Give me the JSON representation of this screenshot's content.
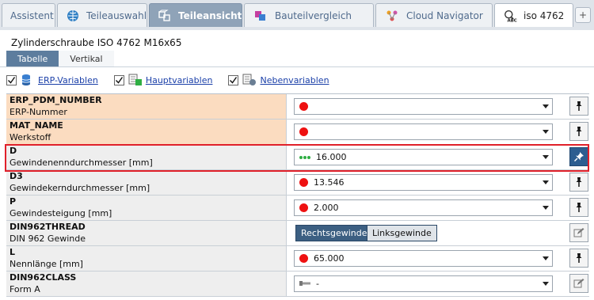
{
  "tabs": [
    {
      "label": "Assistent",
      "icon": "",
      "active": false
    },
    {
      "label": "Teileauswahl",
      "icon": "globe-icon",
      "active": false
    },
    {
      "label": "Teileansicht",
      "icon": "parts-view-icon",
      "active": true
    },
    {
      "label": "Bauteilvergleich",
      "icon": "compare-icon",
      "active": false
    },
    {
      "label": "Cloud Navigator",
      "icon": "cloud-navigator-icon",
      "active": false
    },
    {
      "label": "iso 4762",
      "icon": "abc-search-icon",
      "active": false
    }
  ],
  "plus_label": "+",
  "part_title": "Zylinderschraube ISO 4762 M16x65",
  "subtabs": [
    {
      "label": "Tabelle",
      "active": true
    },
    {
      "label": "Vertikal",
      "active": false
    }
  ],
  "filters": [
    {
      "label": "ERP-Variablen",
      "checked": true,
      "icon": "database-icon"
    },
    {
      "label": "Hauptvariablen",
      "checked": true,
      "icon": "main-variables-icon"
    },
    {
      "label": "Nebenvariablen",
      "checked": true,
      "icon": "secondary-variables-icon"
    }
  ],
  "rows": [
    {
      "key": "ERP_PDM_NUMBER",
      "desc": "ERP-Nummer",
      "value": "",
      "status": "red",
      "orange": true,
      "action": "pin"
    },
    {
      "key": "MAT_NAME",
      "desc": "Werkstoff",
      "value": "",
      "status": "red",
      "orange": true,
      "action": "pin"
    },
    {
      "key": "D",
      "desc": "Gewindenenndurchmesser [mm]",
      "value": "16.000",
      "status": "green",
      "orange": false,
      "action": "pin-active"
    },
    {
      "key": "D3",
      "desc": "Gewindekerndurchmesser [mm]",
      "value": "13.546",
      "status": "red",
      "orange": false,
      "action": "pin"
    },
    {
      "key": "P",
      "desc": "Gewindesteigung [mm]",
      "value": "2.000",
      "status": "red",
      "orange": false,
      "action": "pin"
    },
    {
      "key": "DIN962THREAD",
      "desc": "DIN 962 Gewinde",
      "value": "",
      "status": "none",
      "orange": false,
      "action": "edit",
      "buttons": [
        "Rechtsgewinde",
        "Linksgewinde"
      ]
    },
    {
      "key": "L",
      "desc": "Nennlänge [mm]",
      "value": "65.000",
      "status": "red",
      "orange": false,
      "action": "pin"
    },
    {
      "key": "DIN962CLASS",
      "desc": "Form A",
      "value": "-",
      "status": "screw",
      "orange": false,
      "action": "edit"
    }
  ],
  "colors": {
    "active_tab": "#8fa3b8",
    "active_subtab": "#5d7d9e",
    "erp_row": "#fbdcc0",
    "status_red": "#ee1111",
    "status_green": "#2fae43",
    "highlight": "#e0202a"
  }
}
